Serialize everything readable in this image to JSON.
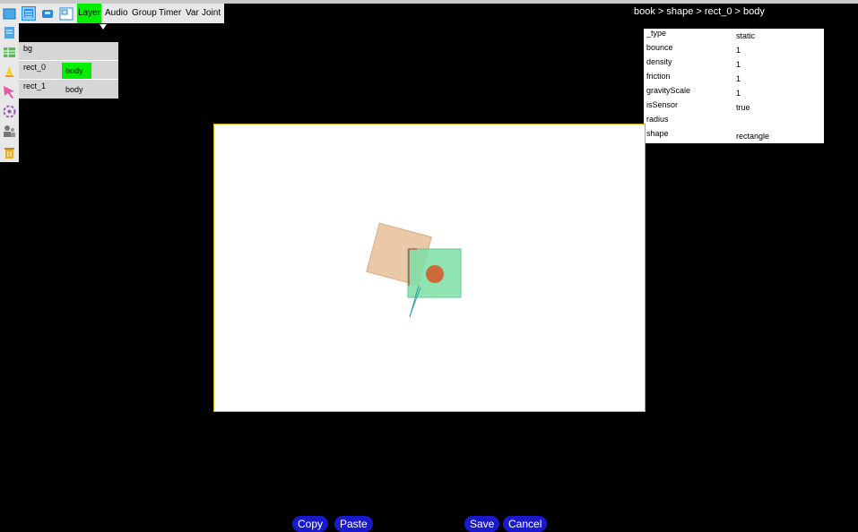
{
  "toolbar": {
    "icons": [
      "book-icon",
      "page-icon",
      "widget-icon",
      "layout-icon"
    ],
    "menus": {
      "layer": "Layer",
      "audio": "Audio",
      "group": "Group",
      "timer": "Timer",
      "var": "Var",
      "joint": "Joint"
    },
    "active_menu": "Layer"
  },
  "sidebar": {
    "icons": [
      "notebook-icon",
      "grid-icon",
      "rocket-icon",
      "pointer-icon",
      "gear-flower-icon",
      "people-icon",
      "trash-icon"
    ]
  },
  "layers": [
    {
      "name": "bg",
      "chip": ""
    },
    {
      "name": "rect_0",
      "chip": "body",
      "selected": true
    },
    {
      "name": "rect_1",
      "chip": "body",
      "selected": false
    }
  ],
  "breadcrumb": "book > shape > rect_0  > body",
  "properties": [
    {
      "key": "_type",
      "value": "static"
    },
    {
      "key": "bounce",
      "value": "1"
    },
    {
      "key": "density",
      "value": "1"
    },
    {
      "key": "friction",
      "value": "1"
    },
    {
      "key": "gravityScale",
      "value": "1"
    },
    {
      "key": "isSensor",
      "value": "true"
    },
    {
      "key": "radius",
      "value": ""
    },
    {
      "key": "shape",
      "value": "rectangle"
    }
  ],
  "buttons": {
    "copy": "Copy",
    "paste": "Paste",
    "save": "Save",
    "cancel": "Cancel"
  },
  "colors": {
    "active": "#00ee00",
    "button": "#1a1acc",
    "stage_border": "#c8b400",
    "shape_tan": "#e8c4a0",
    "shape_green": "#7de0a8",
    "circle": "#cc6a3c"
  }
}
